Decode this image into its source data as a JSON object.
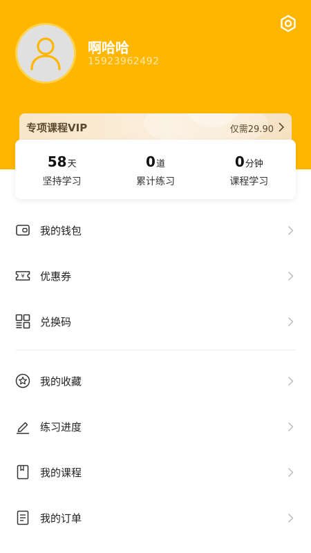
{
  "profile": {
    "username": "啊哈哈",
    "phone": "15923962492"
  },
  "vip": {
    "title": "专项课程VIP",
    "price": "仅需29.90"
  },
  "stats": [
    {
      "value": "58",
      "unit": "天",
      "label": "坚持学习"
    },
    {
      "value": "0",
      "unit": "道",
      "label": "累计练习"
    },
    {
      "value": "0",
      "unit": "分钟",
      "label": "课程学习"
    }
  ],
  "menu_group1": [
    {
      "label": "我的钱包",
      "icon": "wallet-icon"
    },
    {
      "label": "优惠券",
      "icon": "coupon-icon"
    },
    {
      "label": "兑换码",
      "icon": "qr-code-icon"
    }
  ],
  "menu_group2": [
    {
      "label": "我的收藏",
      "icon": "star-icon"
    },
    {
      "label": "练习进度",
      "icon": "pencil-icon"
    },
    {
      "label": "我的课程",
      "icon": "book-icon"
    },
    {
      "label": "我的订单",
      "icon": "order-icon"
    }
  ],
  "colors": {
    "header": "#FFB600",
    "vip_text": "#5c4a2e"
  }
}
